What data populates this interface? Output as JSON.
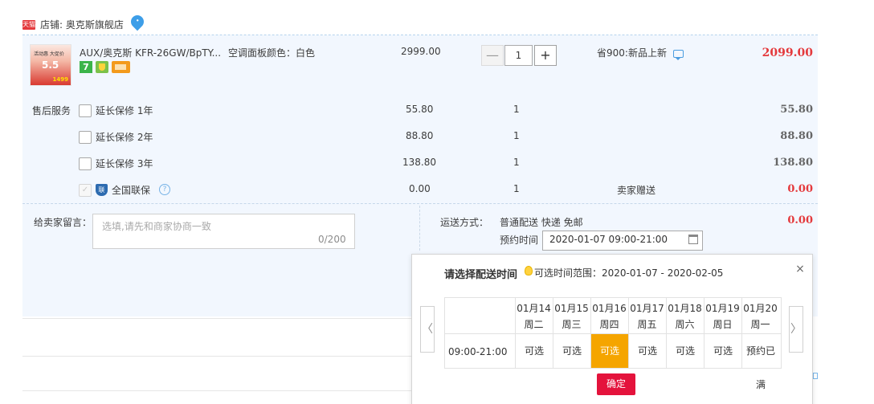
{
  "shop": {
    "badge": "天猫",
    "label": "店铺: 奥克斯旗舰店"
  },
  "product": {
    "thumb_top": "活动惠 大促价",
    "thumb_mid": "5.5",
    "thumb_price": "1499",
    "title": "AUX/奥克斯 KFR-26GW/BpTY...",
    "spec": "空调面板颜色：白色",
    "badge_7": "7",
    "unit_price": "2999.00",
    "qty_minus": "—",
    "qty": "1",
    "qty_plus": "+",
    "promo": "省900:新品上新",
    "total": "2099.00"
  },
  "services": {
    "label": "售后服务",
    "items": [
      {
        "name": "延长保修 1年",
        "price": "55.80",
        "qty": "1",
        "total": "55.80"
      },
      {
        "name": "延长保修 2年",
        "price": "88.80",
        "qty": "1",
        "total": "88.80"
      },
      {
        "name": "延长保修 3年",
        "price": "138.80",
        "qty": "1",
        "total": "138.80"
      },
      {
        "name": "全国联保",
        "price": "0.00",
        "qty": "1",
        "note": "卖家赠送",
        "total": "0.00"
      }
    ],
    "lianbao_glyph": "联",
    "help_glyph": "?",
    "check_glyph": "✓"
  },
  "message": {
    "label": "给卖家留言：",
    "placeholder": "选填,请先和商家协商一致",
    "count": "0/200"
  },
  "shipping": {
    "label": "运送方式：",
    "value": "普通配送 快递 免邮",
    "total": "0.00",
    "appt_label": "预约时间",
    "appt_value": "2020-01-07 09:00-21:00"
  },
  "popup": {
    "title": "请选择配送时间",
    "range": "可选时间范围：2020-01-07 - 2020-02-05",
    "close": "×",
    "prev": "〈",
    "next": "〉",
    "slot_label": "09:00-21:00",
    "days": [
      {
        "date": "01月14",
        "week": "周二",
        "status": "可选"
      },
      {
        "date": "01月15",
        "week": "周三",
        "status": "可选"
      },
      {
        "date": "01月16",
        "week": "周四",
        "status": "可选"
      },
      {
        "date": "01月17",
        "week": "周五",
        "status": "可选"
      },
      {
        "date": "01月18",
        "week": "周六",
        "status": "可选"
      },
      {
        "date": "01月19",
        "week": "周日",
        "status": "可选"
      },
      {
        "date": "01月20",
        "week": "周一",
        "status": "预约已满"
      }
    ],
    "confirm": "确定"
  },
  "colors": {
    "accent_red": "#e4393c",
    "selected_orange": "#f5a500",
    "confirm_red": "#e4133c",
    "panel_blue": "#f2f7fe"
  }
}
